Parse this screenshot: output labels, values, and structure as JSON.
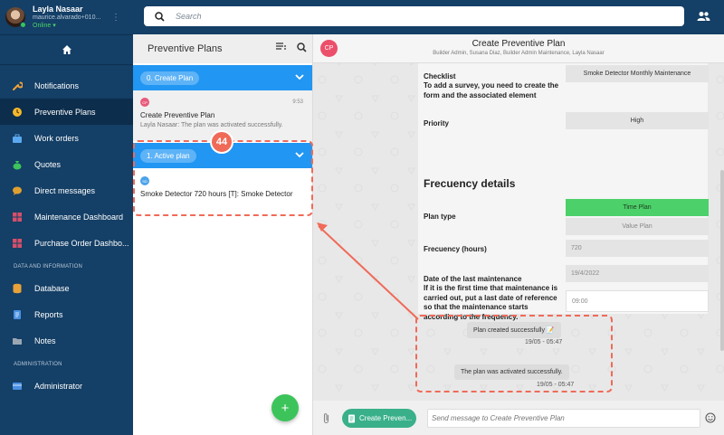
{
  "user": {
    "name": "Layla Nasaar",
    "email": "maurice.alvarado+010...",
    "status": "Online"
  },
  "search": {
    "placeholder": "Search"
  },
  "nav": {
    "items": [
      {
        "label": "Notifications",
        "icon": "wrench-icon"
      },
      {
        "label": "Preventive Plans",
        "icon": "clock-icon"
      },
      {
        "label": "Work orders",
        "icon": "briefcase-icon"
      },
      {
        "label": "Quotes",
        "icon": "money-bag-icon"
      },
      {
        "label": "Direct messages",
        "icon": "chat-bubble-icon"
      },
      {
        "label": "Maintenance Dashboard",
        "icon": "grid-icon"
      },
      {
        "label": "Purchase Order Dashbo...",
        "icon": "grid-icon"
      }
    ],
    "section_data": "DATA AND INFORMATION",
    "data_items": [
      {
        "label": "Database",
        "icon": "database-icon"
      },
      {
        "label": "Reports",
        "icon": "document-icon"
      },
      {
        "label": "Notes",
        "icon": "folder-icon"
      }
    ],
    "section_admin": "ADMINISTRATION",
    "admin_items": [
      {
        "label": "Administrator",
        "icon": "admin-icon"
      }
    ]
  },
  "plans_panel": {
    "title": "Preventive Plans",
    "group_create": "0. Create Plan",
    "create_card": {
      "avatar": "CP",
      "time": "9:53",
      "title": "Create Preventive Plan",
      "message": "Layla Nasaar: The plan was activated successfully."
    },
    "group_active": "1. Active plan",
    "active_card": {
      "avatar": "SD",
      "title": "Smoke Detector 720 hours [T]: Smoke Detector"
    },
    "fab": "+"
  },
  "chat": {
    "avatar": "CP",
    "title": "Create Preventive Plan",
    "subtitle": "Builder Admin, Susana Diaz, Builder Admin Maintenance, Layla Nasaar",
    "form": {
      "checklist_label": "Checklist\nTo add a survey, you need to create the form and the associated element",
      "checklist_value": "Smoke Detector Monthly Maintenance",
      "priority_label": "Priority",
      "priority_value": "High",
      "frequency_heading": "Frecuency details",
      "plan_type_label": "Plan type",
      "plan_type_options": [
        "Time Plan",
        "Value Plan"
      ],
      "frequency_hours_label": "Frecuency (hours)",
      "frequency_hours_value": "720",
      "last_maintenance_label": "Date of the last maintenance\nIf it is the first time that maintenance is carried out, put a last date of reference so that the maintenance starts according to the frequency.",
      "last_maintenance_date": "19/4/2022",
      "last_maintenance_time": "09:00"
    },
    "messages": [
      {
        "text": "Plan created successfully 📝",
        "time": "19/05 - 05:47"
      },
      {
        "text": "The plan was activated successfully.",
        "time": "19/05 - 05:47"
      }
    ],
    "composer": {
      "template_label": "Create Preven...",
      "placeholder": "Send message to Create Preventive Plan"
    }
  },
  "annotation": {
    "number": "44"
  },
  "colors": {
    "sidebar": "#143f66",
    "accent_blue": "#2196f3",
    "accent_green": "#4cd06a",
    "annotation": "#f06a58"
  }
}
